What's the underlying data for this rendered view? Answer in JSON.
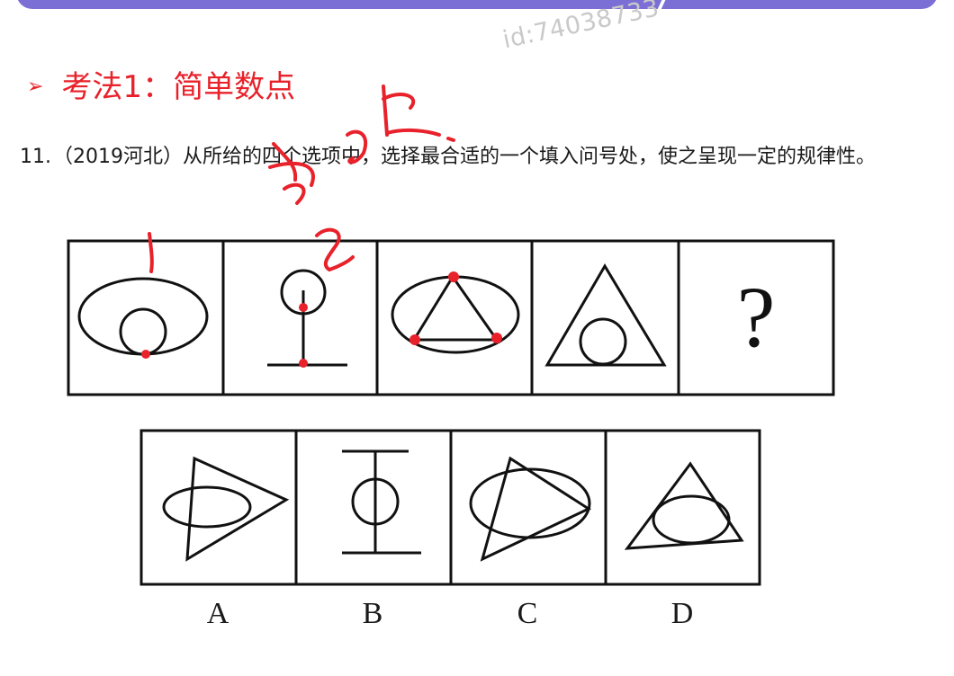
{
  "watermark": "id:74038733",
  "heading": {
    "arrow_icon": "triangle-right-icon",
    "text": "考法1：简单数点"
  },
  "question": {
    "number": "11.",
    "source": "（2019河北）",
    "stem": "从所给的四个选项中，选择最合适的一个填入问号处，使之呈现一定的规律性。"
  },
  "sequence": {
    "missing_symbol": "?"
  },
  "options": {
    "a": "A",
    "b": "B",
    "c": "C",
    "d": "D"
  },
  "annotation": {
    "color": "#e8212a"
  }
}
